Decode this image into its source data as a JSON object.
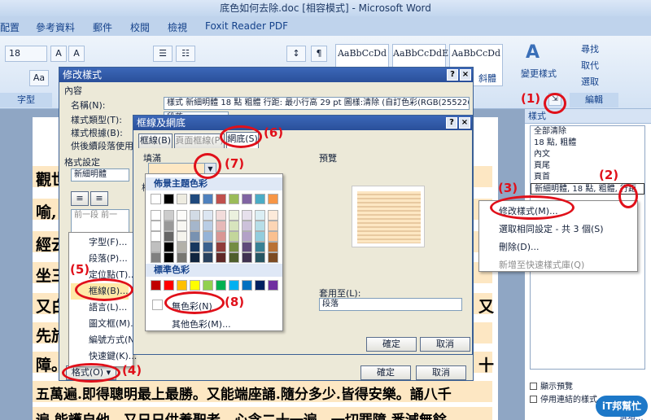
{
  "window": {
    "title": "底色如何去除.doc [相容模式] - Microsoft Word"
  },
  "ribbon_tabs": [
    "配置",
    "參考資料",
    "郵件",
    "校閱",
    "檢視",
    "Foxit Reader PDF"
  ],
  "ribbon": {
    "font_size": "18",
    "group_font": "字型",
    "group_edit": "編輯",
    "style_samples": [
      "AaBbCcDd",
      "AaBbCcDdE",
      "AaBbCcDd"
    ],
    "change_styles": "變更樣式",
    "find": "尋找",
    "replace": "取代",
    "select": "選取",
    "style_extra_label": "斜體"
  },
  "document": {
    "lines": [
      "觀世",
      "喻,",
      "經云",
      "坐三",
      "又白",
      "先於",
      "障。",
      "五萬遍.即得聰明最上最勝。又能端座誦.隨分多少.皆得安樂。誦八千",
      "遍.能護自他。又日日供養聖者。心念二十一遍。一切罪障.悉減無餘。"
    ],
    "right_chars": [
      "十",
      "又"
    ]
  },
  "styles_pane": {
    "title": "樣式",
    "items": [
      "全部清除",
      "18 點, 粗體",
      "內文",
      "頁尾",
      "頁首",
      "新細明體, 18 點, 粗體, 行距"
    ],
    "show_preview": "顯示預覽",
    "disable_linked": "停用連結的樣式",
    "options": "選項..."
  },
  "context_menu": {
    "items": [
      "修改樣式(M)...",
      "選取相同設定 - 共 3 個(S)",
      "刪除(D)...",
      "新增至快速樣式庫(Q)"
    ]
  },
  "modify_dialog": {
    "title": "修改樣式",
    "section_content": "內容",
    "name_label": "名稱(N):",
    "name_value": "樣式 新細明體 18 點 粗體 行距:  最小行高 29 pt 圖樣:清除 (自訂色彩(RGB(255226176)...",
    "type_label": "樣式類型(T):",
    "type_value": "段落",
    "base_label": "樣式根據(B):",
    "next_label": "供後續段落使用之",
    "format_label": "格式設定",
    "font_value": "新細明體",
    "preview_text": "前一段  前一",
    "format_button": "格式(O)",
    "ok": "確定",
    "cancel": "取消"
  },
  "format_menu": {
    "items": [
      "字型(F)...",
      "段落(P)...",
      "定位點(T)...",
      "框線(B)...",
      "語言(L)...",
      "圖文框(M)...",
      "編號方式(N)...",
      "快速鍵(K)..."
    ]
  },
  "borders_dialog": {
    "title": "框線及網底",
    "tabs": [
      "框線(B)",
      "頁面框線(P)",
      "網底(S)"
    ],
    "fill_label": "填滿",
    "preview_label": "預覽",
    "apply_label": "套用至(L):",
    "apply_value": "段落",
    "style_label_partial": "樣",
    "ok": "確定",
    "cancel": "取消"
  },
  "palette": {
    "theme_title": "佈景主題色彩",
    "standard_title": "標準色彩",
    "no_color": "無色彩(N)",
    "more_colors": "其他色彩(M)...",
    "theme_colors": [
      "#ffffff",
      "#000000",
      "#eeece1",
      "#1f497d",
      "#4f81bd",
      "#c0504d",
      "#9bbb59",
      "#8064a2",
      "#4bacc6",
      "#f79646"
    ],
    "standard_colors": [
      "#c00000",
      "#ff0000",
      "#ffc000",
      "#ffff00",
      "#92d050",
      "#00b050",
      "#00b0f0",
      "#0070c0",
      "#002060",
      "#7030a0"
    ]
  },
  "annotations": [
    "(1)",
    "(2)",
    "(3)",
    "(4)",
    "(5)",
    "(6)",
    "(7)",
    "(8)"
  ],
  "brand": {
    "logo": "iT邦幫忙"
  }
}
